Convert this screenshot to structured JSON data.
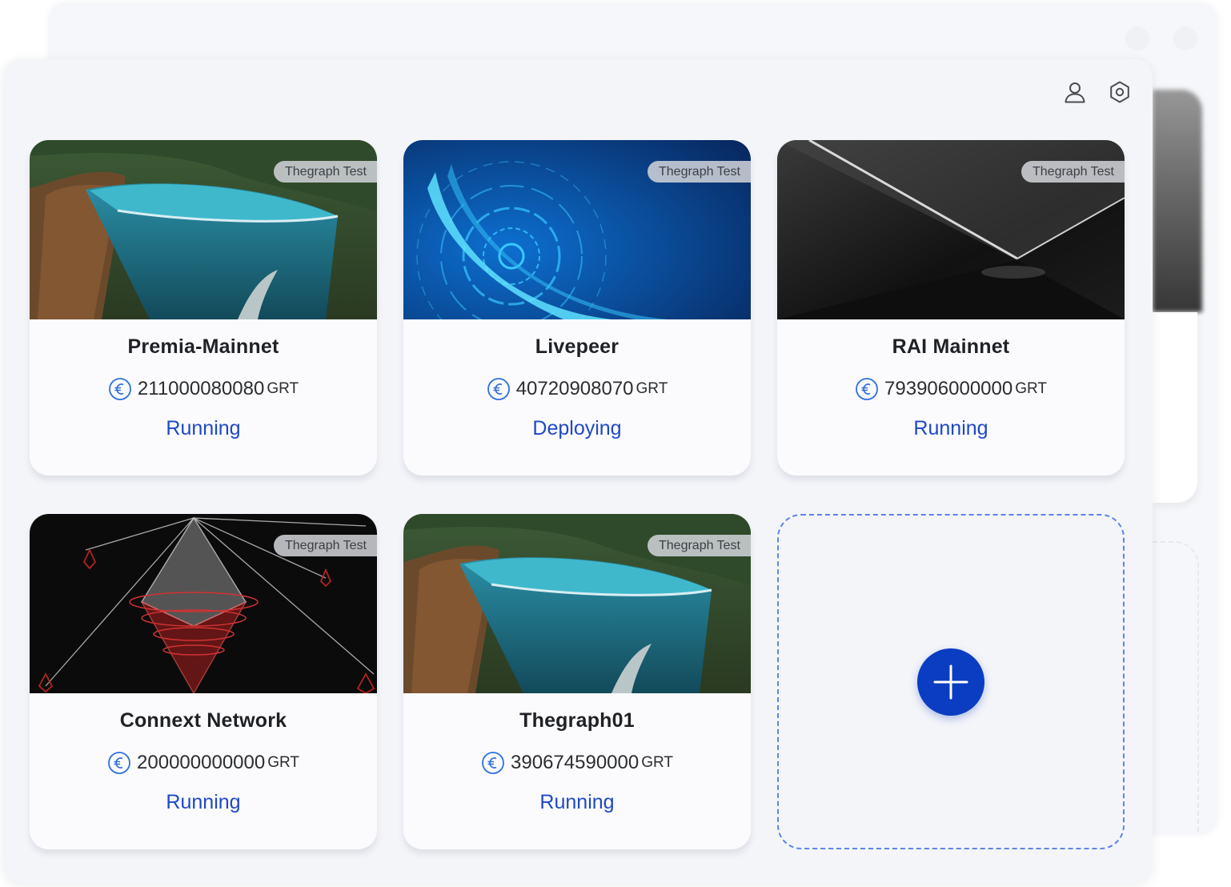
{
  "toolbar": {
    "icons": [
      "user-icon",
      "gear-icon"
    ]
  },
  "cards": [
    {
      "tag": "Thegraph Test",
      "title": "Premia-Mainnet",
      "amount": "211000080080",
      "unit": "GRT",
      "status": "Running",
      "image": "cliff-lake-whale"
    },
    {
      "tag": "Thegraph Test",
      "title": "Livepeer",
      "amount": "40720908070",
      "unit": "GRT",
      "status": "Deploying",
      "image": "blue-digital-spiral"
    },
    {
      "tag": "Thegraph Test",
      "title": "RAI Mainnet",
      "amount": "793906000000",
      "unit": "GRT",
      "status": "Running",
      "image": "dark-tunnel"
    },
    {
      "tag": "Thegraph Test",
      "title": "Connext Network",
      "amount": "200000000000",
      "unit": "GRT",
      "status": "Running",
      "image": "red-ethereum-crystal"
    },
    {
      "tag": "Thegraph Test",
      "title": "Thegraph01",
      "amount": "390674590000",
      "unit": "GRT",
      "status": "Running",
      "image": "cliff-lake-whale"
    }
  ],
  "add_card": {
    "icon": "plus-icon"
  },
  "colors": {
    "accent": "#0a3dc2",
    "status_text": "#1e48c6",
    "dashed_border": "#5b86e5",
    "coin": "#2f6fe0"
  }
}
